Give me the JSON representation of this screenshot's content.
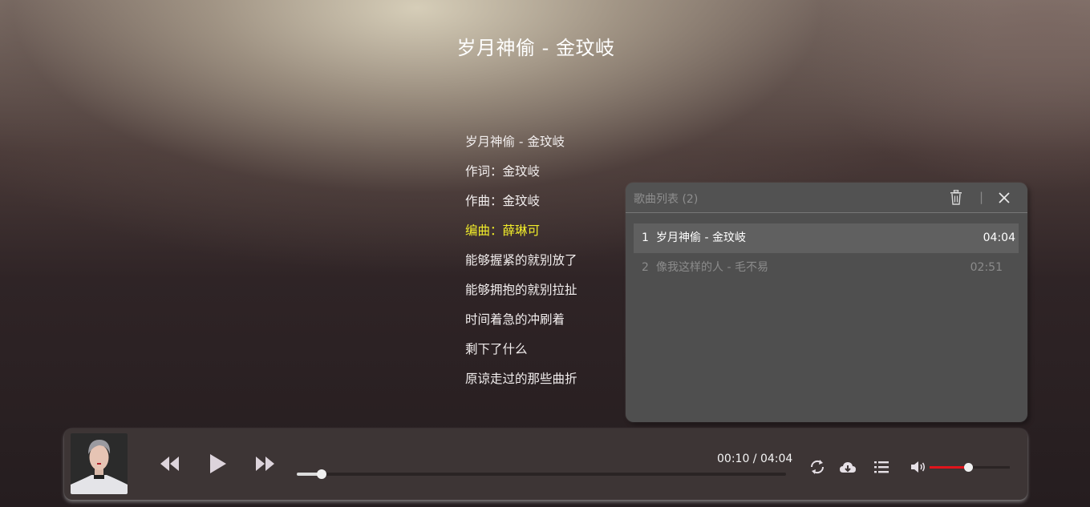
{
  "page": {
    "title": "岁月神偷 - 金玟岐"
  },
  "lyrics": [
    {
      "text": "岁月神偷 - 金玟岐",
      "active": false
    },
    {
      "text": "作词：金玟岐",
      "active": false
    },
    {
      "text": "作曲：金玟岐",
      "active": false
    },
    {
      "text": "编曲：薛琳可",
      "active": true
    },
    {
      "text": "能够握紧的就别放了",
      "active": false
    },
    {
      "text": "能够拥抱的就别拉扯",
      "active": false
    },
    {
      "text": "时间着急的冲刷着",
      "active": false
    },
    {
      "text": "剩下了什么",
      "active": false
    },
    {
      "text": "原谅走过的那些曲折",
      "active": false
    }
  ],
  "playlist": {
    "title": "歌曲列表 (2)",
    "separator": "|",
    "icons": {
      "clear": "trash-icon",
      "close": "close-icon"
    },
    "songs": [
      {
        "index": "1",
        "name": "岁月神偷 - 金玟岐",
        "duration": "04:04",
        "current": true
      },
      {
        "index": "2",
        "name": "像我这样的人 - 毛不易",
        "duration": "02:51",
        "current": false
      }
    ]
  },
  "player": {
    "time_display": "00:10 / 04:04",
    "progress_fraction": 0.05,
    "volume_fraction": 0.48,
    "icons": {
      "prev": "prev-icon",
      "play": "play-icon",
      "next": "next-icon",
      "loop": "loop-icon",
      "download": "cloud-download-icon",
      "playlist": "list-icon",
      "volume": "volume-icon"
    },
    "colors": {
      "volume_accent": "#e0141c",
      "active_lyric": "#f2ee2a"
    }
  }
}
